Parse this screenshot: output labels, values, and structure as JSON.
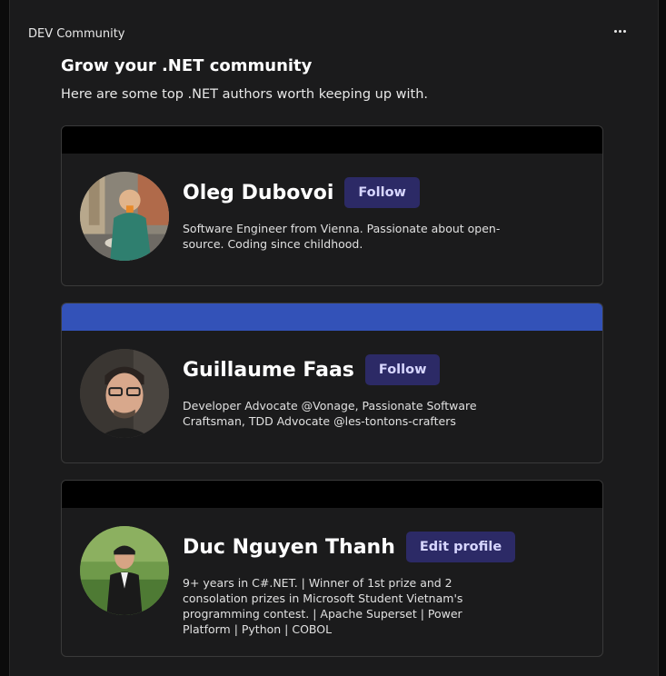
{
  "header": {
    "brand": "DEV Community",
    "more_icon": "more-horizontal-icon"
  },
  "intro": {
    "title": "Grow your .NET community",
    "subtitle": "Here are some top .NET authors worth keeping up with."
  },
  "authors": [
    {
      "name": "Oleg Dubovoi",
      "button": "Follow",
      "bio": "Software Engineer from Vienna. Passionate about open-source. Coding since childhood.",
      "banner_color": "#000000"
    },
    {
      "name": "Guillaume Faas",
      "button": "Follow",
      "bio": "Developer Advocate @Vonage, Passionate Software Craftsman, TDD Advocate @les-tontons-crafters",
      "banner_color": "#3352b8"
    },
    {
      "name": "Duc Nguyen Thanh",
      "button": "Edit profile",
      "bio": "9+ years in C#.NET. | Winner of 1st prize and 2 consolation prizes in Microsoft Student Vietnam's programming contest. | Apache Superset | Power Platform | Python | COBOL",
      "banner_color": "#000000"
    }
  ]
}
